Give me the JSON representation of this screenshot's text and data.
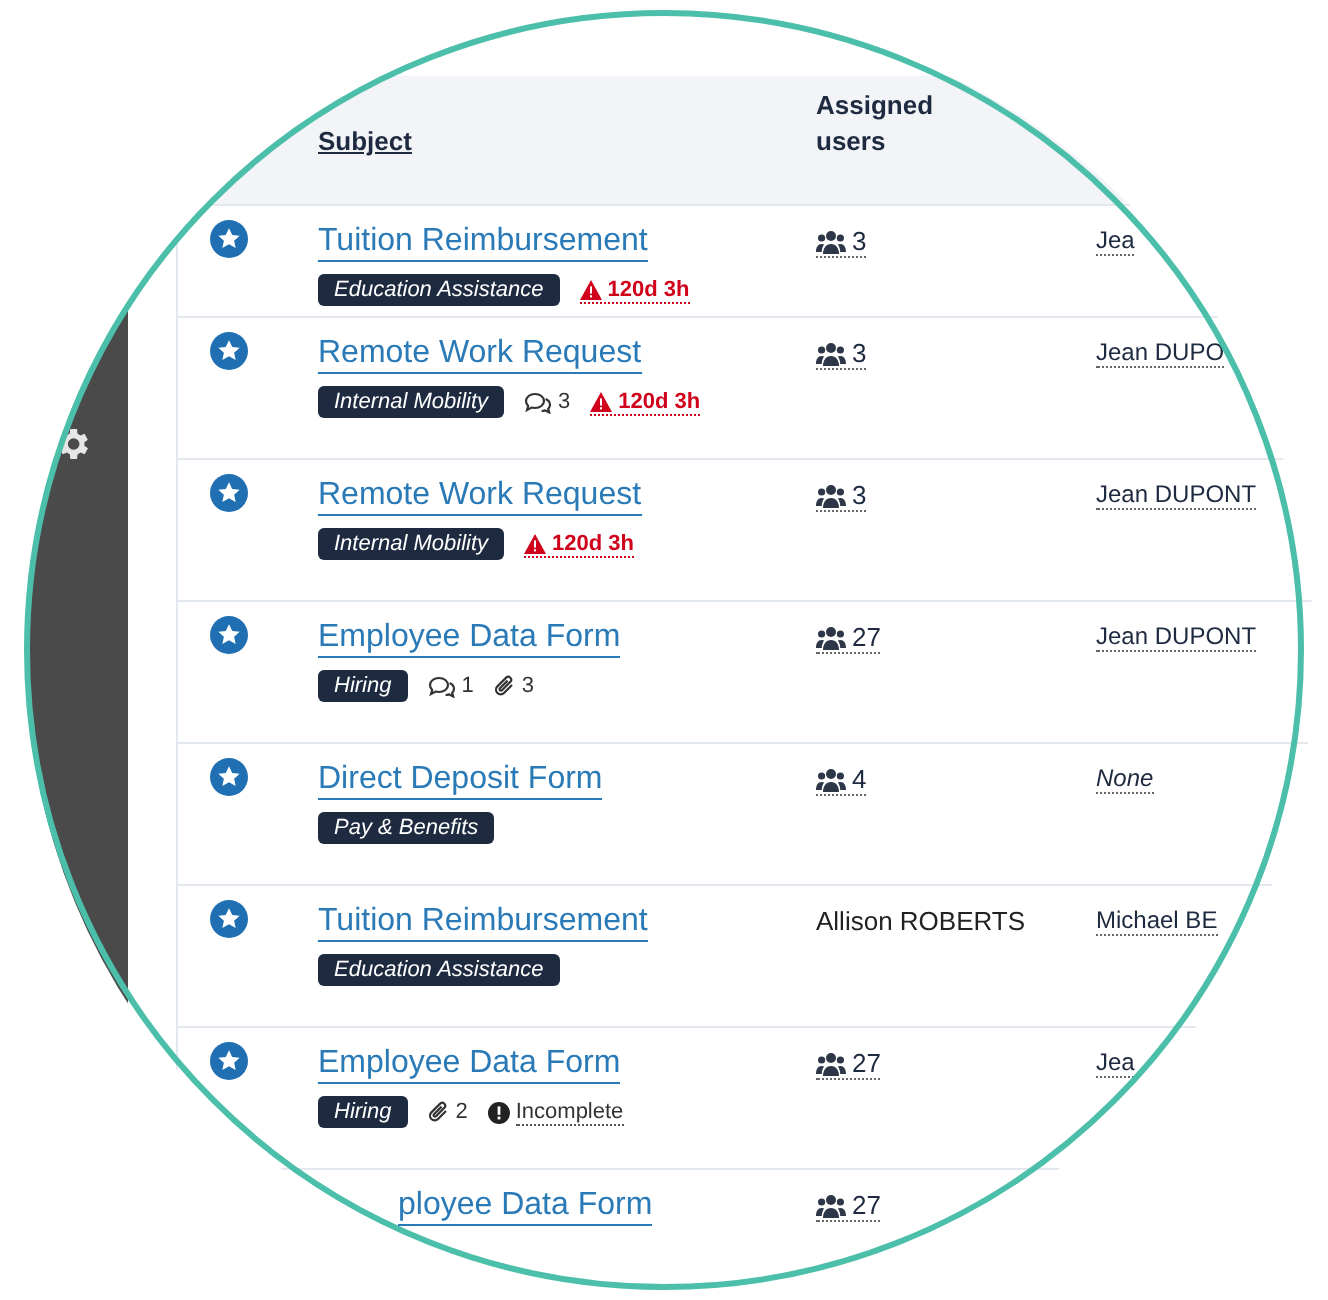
{
  "table": {
    "columns": [
      {
        "label": "Subject"
      },
      {
        "label": "Assigned users"
      }
    ],
    "rows": [
      {
        "title": "Tuition Reimbursement",
        "tag": "Education Assistance",
        "meta": [
          {
            "kind": "overdue",
            "text": "120d 3h"
          }
        ],
        "users": {
          "kind": "count",
          "text": "3"
        },
        "column_3": {
          "kind": "person",
          "text": "Jea"
        }
      },
      {
        "title": "Remote Work Request",
        "tag": "Internal Mobility",
        "meta": [
          {
            "kind": "comments",
            "text": "3"
          },
          {
            "kind": "overdue",
            "text": "120d 3h"
          }
        ],
        "users": {
          "kind": "count",
          "text": "3"
        },
        "column_3": {
          "kind": "person",
          "text": "Jean DUPO"
        }
      },
      {
        "title": "Remote Work Request",
        "tag": "Internal Mobility",
        "meta": [
          {
            "kind": "overdue",
            "text": "120d 3h"
          }
        ],
        "users": {
          "kind": "count",
          "text": "3"
        },
        "column_3": {
          "kind": "person",
          "text": "Jean DUPONT"
        }
      },
      {
        "title": "Employee Data Form",
        "tag": "Hiring",
        "meta": [
          {
            "kind": "comments",
            "text": "1"
          },
          {
            "kind": "attachments",
            "text": "3"
          }
        ],
        "users": {
          "kind": "count",
          "text": "27"
        },
        "column_3": {
          "kind": "person",
          "text": "Jean DUPONT"
        }
      },
      {
        "title": "Direct Deposit Form",
        "tag": "Pay & Benefits",
        "meta": [],
        "users": {
          "kind": "count",
          "text": "4"
        },
        "column_3": {
          "kind": "none",
          "text": "None"
        }
      },
      {
        "title": "Tuition Reimbursement",
        "tag": "Education Assistance",
        "meta": [],
        "users": {
          "kind": "name",
          "text": "Allison ROBERTS"
        },
        "column_3": {
          "kind": "person",
          "text": "Michael BE"
        }
      },
      {
        "title": "Employee Data Form",
        "tag": "Hiring",
        "meta": [
          {
            "kind": "attachments",
            "text": "2"
          },
          {
            "kind": "status",
            "text": "Incomplete"
          }
        ],
        "users": {
          "kind": "count",
          "text": "27"
        },
        "column_3": {
          "kind": "person",
          "text": "Jea"
        }
      },
      {
        "title": "ployee Data Form",
        "users": {
          "kind": "count",
          "text": "27"
        }
      }
    ]
  }
}
